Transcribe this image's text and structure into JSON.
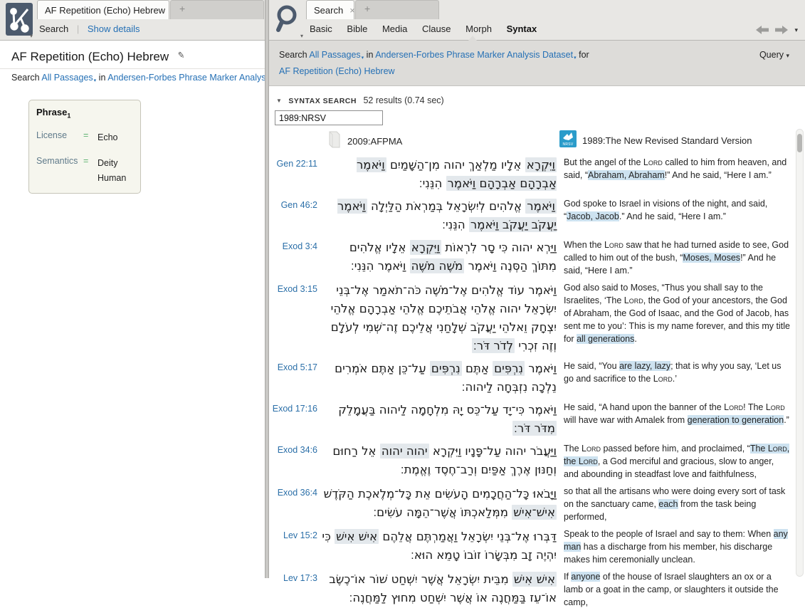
{
  "colors": {
    "link_blue": "#2570b5",
    "ref_blue": "#2b6fa8",
    "english_highlight": "#cde2f0",
    "hebrew_highlight": "#e3e8ec",
    "icon_slate": "#4c5a6d",
    "nrsv_blue": "#2b9cca",
    "equals_green": "#5cb270",
    "chrome_gray": "#e8e7e4",
    "band_gray": "#dddcd9"
  },
  "left_panel": {
    "tab": {
      "title": "AF Repetition (Echo) Hebrew",
      "close": "×",
      "new_tab": "+"
    },
    "toolbar": {
      "search": "Search",
      "show_details": "Show details"
    },
    "title": "AF Repetition (Echo) Hebrew",
    "search_line": {
      "prefix": "Search",
      "scope": "All Passages",
      "in_word": "in",
      "dataset": "Andersen-Forbes Phrase Marker Analysis D"
    },
    "phrase_box": {
      "title": "Phrase",
      "subscript": "1",
      "rows": [
        {
          "label": "License",
          "op": "=",
          "values": [
            "Echo"
          ]
        },
        {
          "label": "Semantics",
          "op": "=",
          "values": [
            "Deity",
            "Human"
          ]
        }
      ]
    }
  },
  "right_panel": {
    "tab": {
      "title": "Search",
      "close": "×",
      "new_tab": "+"
    },
    "nav_tabs": [
      "Basic",
      "Bible",
      "Media",
      "Clause",
      "Morph",
      "Syntax"
    ],
    "active_nav": "Syntax",
    "search_line": {
      "prefix": "Search",
      "scope": "All Passages",
      "in_word": "in",
      "dataset": "Andersen-Forbes Phrase Marker Analysis Dataset",
      "for_word": "for",
      "query_name": "AF Repetition (Echo) Hebrew"
    },
    "query_menu": "Query",
    "results_header": {
      "section": "Syntax Search",
      "count": "52 results (0.74 sec)"
    },
    "filter_input_value": "1989:NRSV",
    "columns": [
      {
        "icon": "book-icon",
        "label": "2009:AFPMA"
      },
      {
        "icon": "nrsv-icon",
        "icon_text": "NRSV",
        "label": "1989:The New Revised Standard Version"
      }
    ],
    "results": [
      {
        "ref": "Gen 22:11",
        "hebrew": [
          {
            "t": "וַיִּקְרָא",
            "hl": true
          },
          {
            "t": "אֵלָיו"
          },
          {
            "t": "מַלְאַךְ"
          },
          {
            "t": "יהוה"
          },
          {
            "t": "מִן־הַשָּׁמַיִם"
          },
          {
            "t": "וַיֹּאמֶר",
            "hl": true
          },
          {
            "t": "אַבְרָהָם",
            "hl": true
          },
          {
            "t": "אַבְרָהָם",
            "hl": true
          },
          {
            "t": "וַיֹּאמֶר",
            "hl": true
          },
          {
            "t": "הִנֵּנִי׃"
          }
        ],
        "english": [
          {
            "t": "But the angel of the "
          },
          {
            "t": "Lord",
            "sc": true
          },
          {
            "t": " called to him from heaven, and said, “"
          },
          {
            "t": "Abraham, Abraham",
            "hl": true
          },
          {
            "t": "!” And he said, “Here I am.”"
          }
        ]
      },
      {
        "ref": "Gen 46:2",
        "hebrew": [
          {
            "t": "וַיֹּאמֶר",
            "hl": true
          },
          {
            "t": "אֱלֹהִים"
          },
          {
            "t": "לְיִשְׂרָאֵל"
          },
          {
            "t": "בְּמַרְאֹת"
          },
          {
            "t": "הַלַּיְלָה"
          },
          {
            "t": "וַיֹּאמֶר",
            "hl": true
          },
          {
            "t": "יַעֲקֹב",
            "hl": true
          },
          {
            "t": "יַעֲקֹב",
            "hl": true
          },
          {
            "t": "וַיֹּאמֶר",
            "hl": true
          },
          {
            "t": "הִנֵּנִי׃"
          }
        ],
        "english": [
          {
            "t": "God spoke to Israel in visions of the night, and said, “"
          },
          {
            "t": "Jacob, Jacob",
            "hl": true
          },
          {
            "t": ".” And he said, “Here I am.”"
          }
        ]
      },
      {
        "ref": "Exod 3:4",
        "hebrew": [
          {
            "t": "וַיַּרְא"
          },
          {
            "t": "יהוה"
          },
          {
            "t": "כִּי"
          },
          {
            "t": "סָר"
          },
          {
            "t": "לִרְאוֹת"
          },
          {
            "t": "וַיִּקְרָא",
            "hl": true
          },
          {
            "t": "אֵלָיו"
          },
          {
            "t": "אֱלֹהִים"
          },
          {
            "t": "מִתּוֹךְ"
          },
          {
            "t": "הַסְּנֶה"
          },
          {
            "t": "וַיֹּאמֶר"
          },
          {
            "t": "מֹשֶׁה",
            "hl": true
          },
          {
            "t": "מֹשֶׁה",
            "hl": true
          },
          {
            "t": "וַיֹּאמֶר"
          },
          {
            "t": "הִנֵּנִי׃"
          }
        ],
        "english": [
          {
            "t": "When the "
          },
          {
            "t": "Lord",
            "sc": true
          },
          {
            "t": " saw that he had turned aside to see, God called to him out of the bush, “"
          },
          {
            "t": "Moses, Moses",
            "hl": true
          },
          {
            "t": "!” And he said, “Here I am.”"
          }
        ]
      },
      {
        "ref": "Exod 3:15",
        "hebrew": [
          {
            "t": "וַיֹּאמֶר"
          },
          {
            "t": "עוֹד"
          },
          {
            "t": "אֱלֹהִים"
          },
          {
            "t": "אֶל־מֹשֶׁה"
          },
          {
            "t": "כֹּה־תֹאמַר"
          },
          {
            "t": "אֶל־בְּנֵי"
          },
          {
            "t": "יִשְׂרָאֵל"
          },
          {
            "t": "יהוה"
          },
          {
            "t": "אֱלֹהֵי"
          },
          {
            "t": "אֲבֹתֵיכֶם"
          },
          {
            "t": "אֱלֹהֵי"
          },
          {
            "t": "אַבְרָהָם"
          },
          {
            "t": "אֱלֹהֵי"
          },
          {
            "t": "יִצְחָק"
          },
          {
            "t": "וֵאלֹהֵי"
          },
          {
            "t": "יַעֲקֹב"
          },
          {
            "t": "שְׁלָחַנִי"
          },
          {
            "t": "אֲלֵיכֶם"
          },
          {
            "t": "זֶה־שְּׁמִי"
          },
          {
            "t": "לְעֹלָם"
          },
          {
            "t": "וְזֶה"
          },
          {
            "t": "זִכְרִי"
          },
          {
            "t": "לְדֹר",
            "hl": true
          },
          {
            "t": "דֹּר׃",
            "hl": true
          }
        ],
        "english": [
          {
            "t": "God also said to Moses, “Thus you shall say to the Israelites, ‘The "
          },
          {
            "t": "Lord",
            "sc": true
          },
          {
            "t": ", the God of your ancestors, the God of Abraham, the God of Isaac, and the God of Jacob, has sent me to you’: This is my name forever, and this my title for "
          },
          {
            "t": "all generations",
            "hl": true
          },
          {
            "t": "."
          }
        ]
      },
      {
        "ref": "Exod 5:17",
        "hebrew": [
          {
            "t": "וַיֹּאמֶר"
          },
          {
            "t": "נִרְפִּים",
            "hl": true
          },
          {
            "t": "אַתֶּם"
          },
          {
            "t": "נִרְפִּים",
            "hl": true
          },
          {
            "t": "עַל־כֵּן"
          },
          {
            "t": "אַתֶּם"
          },
          {
            "t": "אֹמְרִים"
          },
          {
            "t": "נֵלְכָה"
          },
          {
            "t": "נִזְבְּחָה"
          },
          {
            "t": "לַיהוה׃"
          }
        ],
        "english": [
          {
            "t": "He said, “You "
          },
          {
            "t": "are lazy, lazy",
            "hl": true
          },
          {
            "t": "; that is why you say, ‘Let us go and sacrifice to the "
          },
          {
            "t": "Lord",
            "sc": true
          },
          {
            "t": ".’"
          }
        ]
      },
      {
        "ref": "Exod 17:16",
        "hebrew": [
          {
            "t": "וַיֹּאמֶר"
          },
          {
            "t": "כִּי־יָד"
          },
          {
            "t": "עַל־כֵּס"
          },
          {
            "t": "יָהּ"
          },
          {
            "t": "מִלְחָמָה"
          },
          {
            "t": "לַיהוה"
          },
          {
            "t": "בַּעֲמָלֵק"
          },
          {
            "t": "מִדֹּר",
            "hl": true
          },
          {
            "t": "דֹּר׃",
            "hl": true
          }
        ],
        "english": [
          {
            "t": "He said, “A hand upon the banner of the "
          },
          {
            "t": "Lord",
            "sc": true
          },
          {
            "t": "! The "
          },
          {
            "t": "Lord",
            "sc": true
          },
          {
            "t": " will have war with Amalek from "
          },
          {
            "t": "generation to generation",
            "hl": true
          },
          {
            "t": ".”"
          }
        ]
      },
      {
        "ref": "Exod 34:6",
        "hebrew": [
          {
            "t": "וַיַּעֲבֹר"
          },
          {
            "t": "יהוה"
          },
          {
            "t": "עַל־פָּנָיו"
          },
          {
            "t": "וַיִּקְרָא"
          },
          {
            "t": "יהוה",
            "hl": true
          },
          {
            "t": "יהוה",
            "hl": true
          },
          {
            "t": "אֵל"
          },
          {
            "t": "רַחוּם"
          },
          {
            "t": "וְחַנּוּן"
          },
          {
            "t": "אֶרֶךְ"
          },
          {
            "t": "אַפַּיִם"
          },
          {
            "t": "וְרַב־חֶסֶד"
          },
          {
            "t": "וֶאֱמֶת׃"
          }
        ],
        "english": [
          {
            "t": "The "
          },
          {
            "t": "Lord",
            "sc": true
          },
          {
            "t": " passed before him, and proclaimed, “"
          },
          {
            "t": "The ",
            "hl": true
          },
          {
            "t": "Lord",
            "sc": true,
            "hl": true
          },
          {
            "t": ", the ",
            "hl": true
          },
          {
            "t": "Lord",
            "sc": true,
            "hl": true
          },
          {
            "t": ", a God merciful and gracious, slow to anger, and abounding in steadfast love and faithfulness,"
          }
        ]
      },
      {
        "ref": "Exod 36:4",
        "hebrew": [
          {
            "t": "וַיָּבֹאוּ"
          },
          {
            "t": "כָּל־הַחֲכָמִים"
          },
          {
            "t": "הָעֹשִׂים"
          },
          {
            "t": "אֵת"
          },
          {
            "t": "כָּל־מְלֶאכֶת"
          },
          {
            "t": "הַקֹּדֶשׁ"
          },
          {
            "t": "אִישׁ־אִישׁ",
            "hl": true
          },
          {
            "t": "מִמְּלַאכְתּוֹ"
          },
          {
            "t": "אֲשֶׁר־הֵמָּה"
          },
          {
            "t": "עֹשִׂים׃"
          }
        ],
        "english": [
          {
            "t": "so that all the artisans who were doing every sort of task on the sanctuary came, "
          },
          {
            "t": "each",
            "hl": true
          },
          {
            "t": " from the task being performed,"
          }
        ]
      },
      {
        "ref": "Lev 15:2",
        "hebrew": [
          {
            "t": "דַּבְּרוּ"
          },
          {
            "t": "אֶל־בְּנֵי"
          },
          {
            "t": "יִשְׂרָאֵל"
          },
          {
            "t": "וַאֲמַרְתֶּם"
          },
          {
            "t": "אֲלֵהֶם"
          },
          {
            "t": "אִישׁ",
            "hl": true
          },
          {
            "t": "אִישׁ",
            "hl": true
          },
          {
            "t": "כִּי"
          },
          {
            "t": "יִהְיֶה"
          },
          {
            "t": "זָב"
          },
          {
            "t": "מִבְּשָׂרוֹ"
          },
          {
            "t": "זוֹבוֹ"
          },
          {
            "t": "טָמֵא"
          },
          {
            "t": "הוּא׃"
          }
        ],
        "english": [
          {
            "t": "Speak to the people of Israel and say to them: When "
          },
          {
            "t": "any man",
            "hl": true
          },
          {
            "t": " has a discharge from his member, his discharge makes him ceremonially unclean."
          }
        ]
      },
      {
        "ref": "Lev 17:3",
        "hebrew": [
          {
            "t": "אִישׁ",
            "hl": true
          },
          {
            "t": "אִישׁ",
            "hl": true
          },
          {
            "t": "מִבֵּית"
          },
          {
            "t": "יִשְׂרָאֵל"
          },
          {
            "t": "אֲשֶׁר"
          },
          {
            "t": "יִשְׁחַט"
          },
          {
            "t": "שׁוֹר"
          },
          {
            "t": "אוֹ־כֶשֶׂב"
          },
          {
            "t": "אוֹ־עֵז"
          },
          {
            "t": "בַּמַּחֲנֶה"
          },
          {
            "t": "אוֹ"
          },
          {
            "t": "אֲשֶׁר"
          },
          {
            "t": "יִשְׁחַט"
          },
          {
            "t": "מִחוּץ"
          },
          {
            "t": "לַמַּחֲנֶה׃"
          }
        ],
        "english": [
          {
            "t": "If "
          },
          {
            "t": "anyone",
            "hl": true
          },
          {
            "t": " of the house of Israel slaughters an ox or a lamb or a goat in the camp, or slaughters it outside the camp,"
          }
        ]
      }
    ]
  }
}
